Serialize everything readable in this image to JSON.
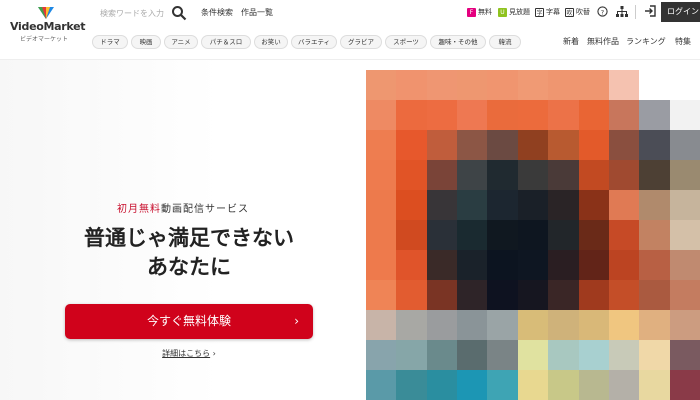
{
  "header": {
    "logo_text": "VideoMarket",
    "logo_sub": "ビデオマーケット",
    "search_placeholder": "検索ワードを入力",
    "links": [
      "条件検索",
      "作品一覧"
    ],
    "utils": [
      {
        "label": "無料",
        "icon": "free-icon",
        "color": "#e4007f"
      },
      {
        "label": "見放題",
        "icon": "unlimited-icon",
        "color": "#8fc31f"
      },
      {
        "label": "字幕",
        "icon": "subtitle-icon",
        "color": "#333333"
      },
      {
        "label": "吹替",
        "icon": "dub-icon",
        "color": "#333333"
      }
    ],
    "login_label": "ログイン"
  },
  "categories": [
    "ドラマ",
    "映画",
    "アニメ",
    "パチ＆スロ",
    "お笑い",
    "バラエティ",
    "グラビア",
    "スポーツ",
    "趣味・その他",
    "韓流"
  ],
  "right_links": [
    "新着",
    "無料作品",
    "ランキング",
    "特集"
  ],
  "hero": {
    "tagline_red": "初月無料",
    "tagline_rest": "動画配信サービス",
    "headline_line1": "普通じゃ満足できない",
    "headline_line2": "あなたに",
    "cta_label": "今すぐ無料体験",
    "cta_arrow": "›",
    "details_label": "詳細はこちら",
    "details_arrow": "›"
  },
  "colors": {
    "accent": "#d0021b",
    "tagline_red": "#c8102e"
  }
}
